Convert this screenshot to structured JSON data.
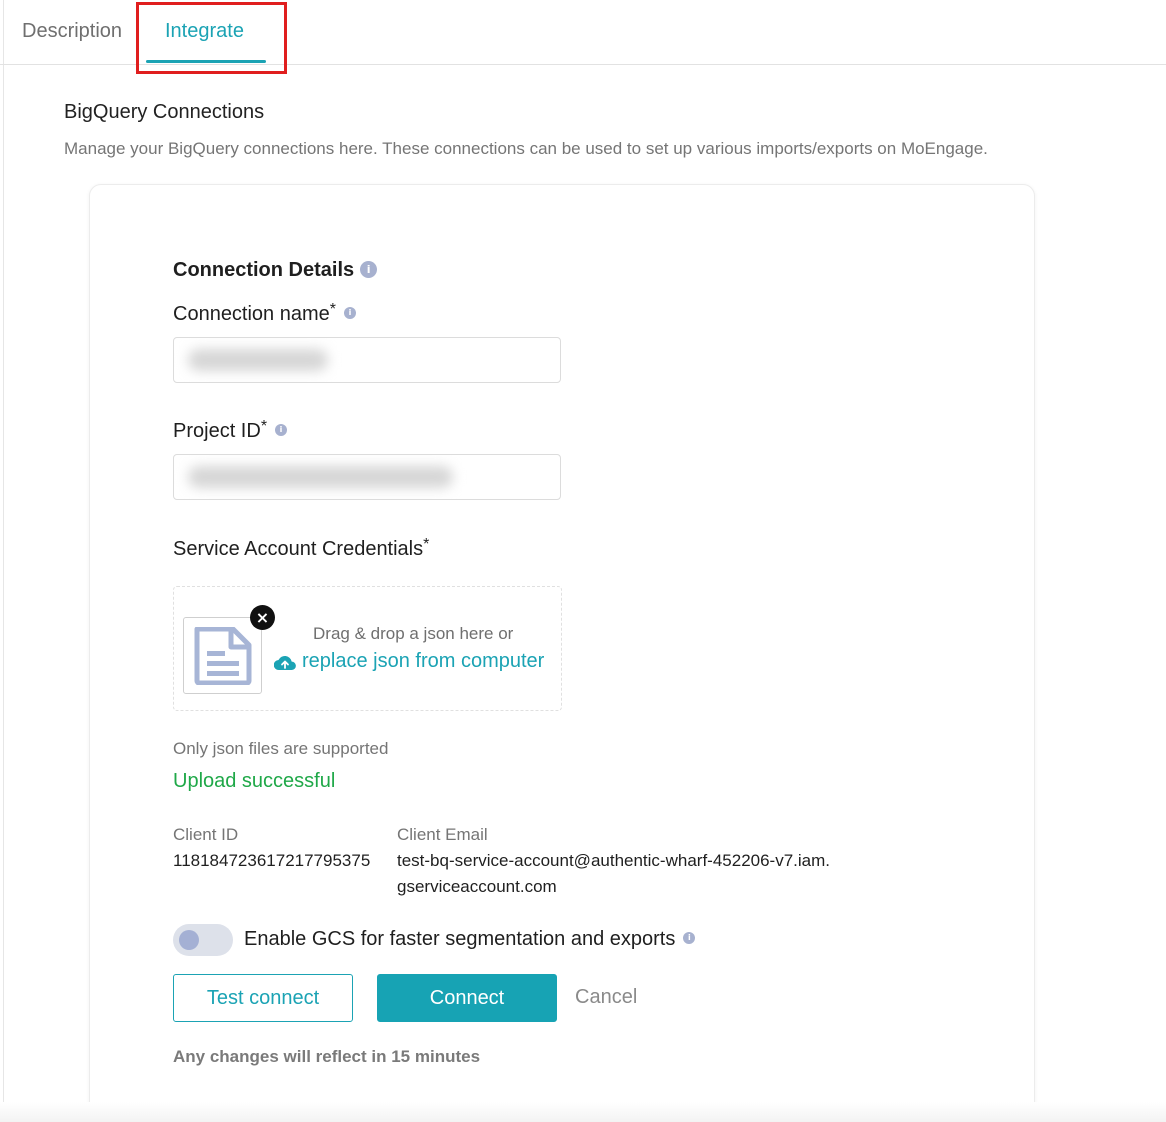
{
  "tabs": [
    {
      "label": "Description",
      "active": false
    },
    {
      "label": "Integrate",
      "active": true
    }
  ],
  "section": {
    "title": "BigQuery Connections",
    "description": "Manage your BigQuery connections here. These connections can be used to set up various imports/exports on MoEngage."
  },
  "form": {
    "heading": "Connection Details",
    "connection_name": {
      "label": "Connection name",
      "required_mark": "*",
      "value": "(redacted)"
    },
    "project_id": {
      "label": "Project ID",
      "required_mark": "*",
      "value": "(redacted)"
    },
    "service_account": {
      "label": "Service Account Credentials",
      "required_mark": "*",
      "drag_text": "Drag & drop a json here or",
      "replace_link": "replace json from computer",
      "hint": "Only json files are supported",
      "status": "Upload successful"
    },
    "client": {
      "id_label": "Client ID",
      "id_value": "118184723617217795375",
      "email_label": "Client Email",
      "email_value": "test-bq-service-account@authentic-wharf-452206-v7.iam.gserviceaccount.com"
    },
    "gcs_toggle": {
      "label": "Enable GCS for faster segmentation and exports",
      "enabled": false
    },
    "buttons": {
      "test_connect": "Test connect",
      "connect": "Connect",
      "cancel": "Cancel"
    },
    "footer_note": "Any changes will reflect in 15 minutes"
  },
  "colors": {
    "accent": "#1ba3b4",
    "success": "#1fa848",
    "highlight": "#e01e1e"
  },
  "icons": {
    "info": "info-icon",
    "file": "document-icon",
    "remove": "close-icon",
    "upload": "cloud-upload-icon"
  }
}
